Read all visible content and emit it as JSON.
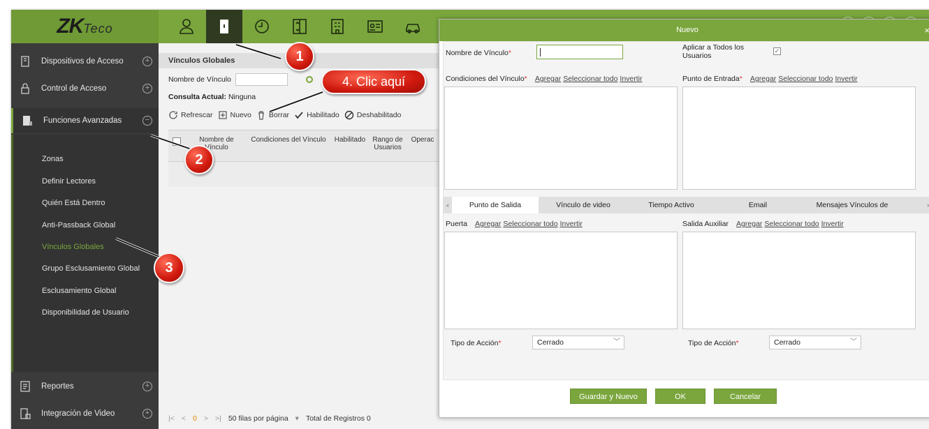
{
  "app": {
    "logo": "ZK",
    "logo_suffix": "Teco"
  },
  "topbar": {
    "icons": [
      "person-icon",
      "door-icon",
      "clock-icon",
      "elevator-icon",
      "building-icon",
      "id-card-icon",
      "car-icon"
    ]
  },
  "sidebar": {
    "main_items": [
      {
        "label": "Dispositivos de Acceso",
        "toggle": "+"
      },
      {
        "label": "Control de Acceso",
        "toggle": "+"
      },
      {
        "label": "Funciones Avanzadas",
        "toggle": "−"
      },
      {
        "label": "Reportes",
        "toggle": "+"
      },
      {
        "label": "Integración de Video",
        "toggle": "+"
      }
    ],
    "sub_items": [
      {
        "label": "Zonas"
      },
      {
        "label": "Definir Lectores"
      },
      {
        "label": "Quién Está Dentro"
      },
      {
        "label": "Anti-Passback Global"
      },
      {
        "label": "Vínculos Globales"
      },
      {
        "label": "Grupo Esclusamiento Global"
      },
      {
        "label": "Esclusamiento Global"
      },
      {
        "label": "Disponibilidad de Usuario"
      }
    ]
  },
  "main": {
    "title": "Vínculos Globales",
    "filter_label": "Nombre de Vínculo",
    "query_label": "Consulta Actual:",
    "query_value": "Ninguna",
    "toolbar": {
      "refresh": "Refrescar",
      "new": "Nuevo",
      "delete": "Borrar",
      "enable": "Habilitado",
      "disable": "Deshabilitado"
    },
    "table_headers": [
      "Nombre de Vínculo",
      "Condiciones del Vínculo",
      "Habilitado",
      "Rango de Usuarios",
      "Operac"
    ],
    "pager": {
      "first": "|<",
      "prev": "<",
      "page": "0",
      "next": ">",
      "last": ">|",
      "per_page": "50 filas por página",
      "total": "Total de Registros 0"
    }
  },
  "modal": {
    "title": "Nuevo",
    "close": "×",
    "name_label": "Nombre de Vínculo",
    "name_value": "",
    "apply_all_label": "Aplicar a Todos los Usuarios",
    "apply_all_checked": true,
    "conditions_label": "Condiciones del Vínculo",
    "entry_label": "Punto de Entrada",
    "door_label": "Puerta",
    "aux_out_label": "Salida Auxiliar",
    "link_add": "Agregar",
    "link_select_all": "Seleccionar todo",
    "link_invert": "Invertir",
    "tabs": [
      "Punto de Salida",
      "Vínculo de video",
      "Tiempo Activo",
      "Email",
      "Mensajes Vínculos de"
    ],
    "active_tab": 0,
    "action_type_label": "Tipo de Acción",
    "action_type_left": "Cerrado",
    "action_type_right": "Cerrado",
    "buttons": {
      "save_new": "Guardar y Nuevo",
      "ok": "OK",
      "cancel": "Cancelar"
    }
  },
  "annotations": {
    "step1": "1",
    "step2": "2",
    "step3": "3",
    "step4": "4. Clic aquí"
  },
  "colors": {
    "brand": "#7aa63d",
    "sidebar": "#3b3b3b",
    "annotation": "#d0190e"
  }
}
